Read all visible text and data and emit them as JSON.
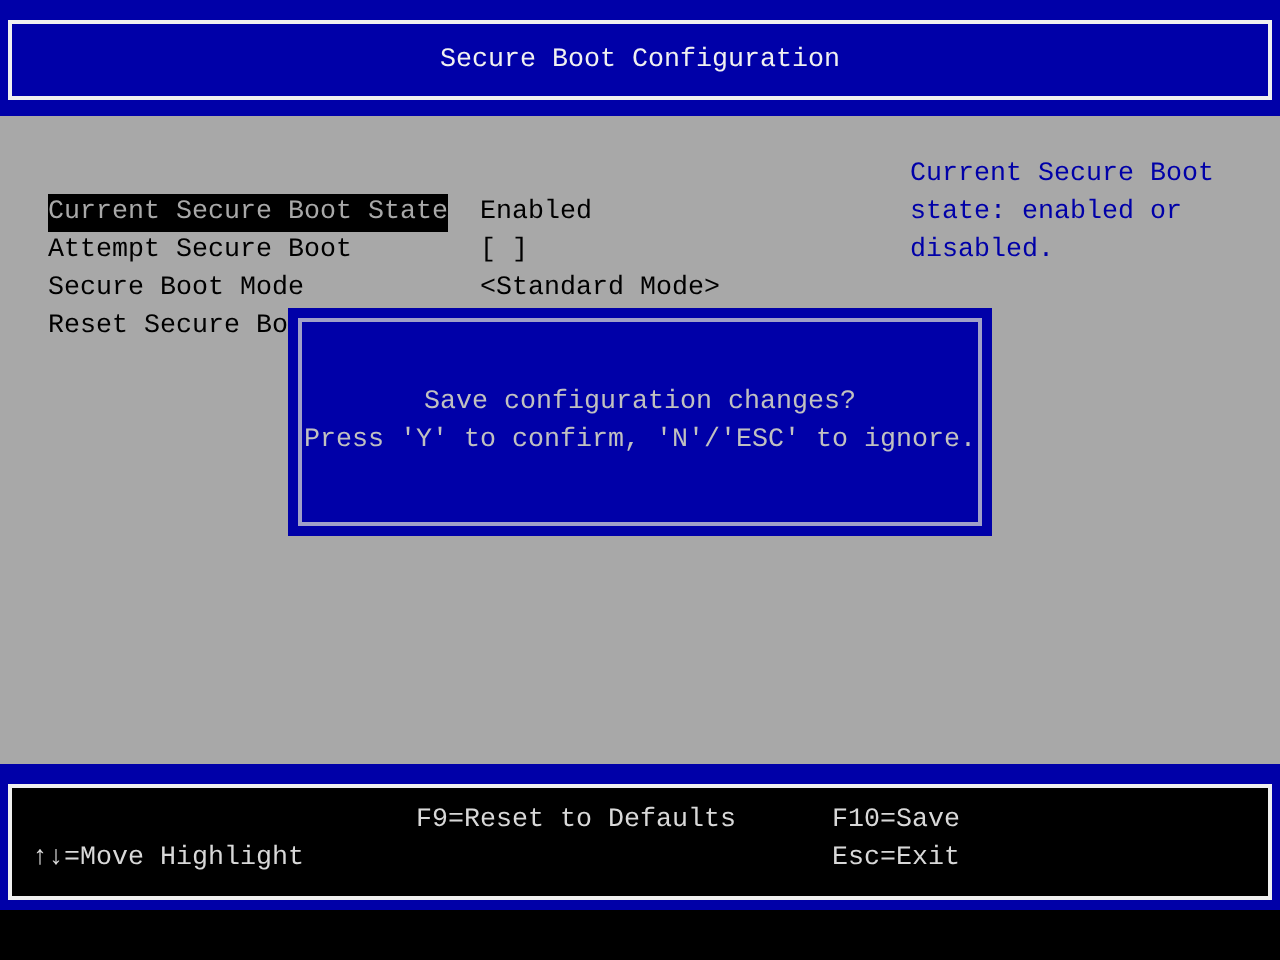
{
  "window": {
    "title": "Secure Boot Configuration"
  },
  "menu": [
    {
      "label": "Current Secure Boot State",
      "value": "Enabled",
      "selected": true
    },
    {
      "label": "Attempt Secure Boot",
      "value": "[ ]",
      "selected": false
    },
    {
      "label": "Secure Boot Mode",
      "value": "<Standard Mode>",
      "selected": false
    },
    {
      "label": "Reset Secure Bo",
      "selected": false
    }
  ],
  "help": "Current Secure Boot state: enabled or disabled.",
  "dialog": {
    "lines": [
      "Save configuration changes?",
      "Press 'Y' to confirm, 'N'/'ESC' to ignore."
    ]
  },
  "footer": {
    "left": [
      "↑↓=Move Highlight"
    ],
    "center": [
      "F9=Reset to Defaults"
    ],
    "right": [
      "F10=Save",
      "Esc=Exit"
    ]
  }
}
